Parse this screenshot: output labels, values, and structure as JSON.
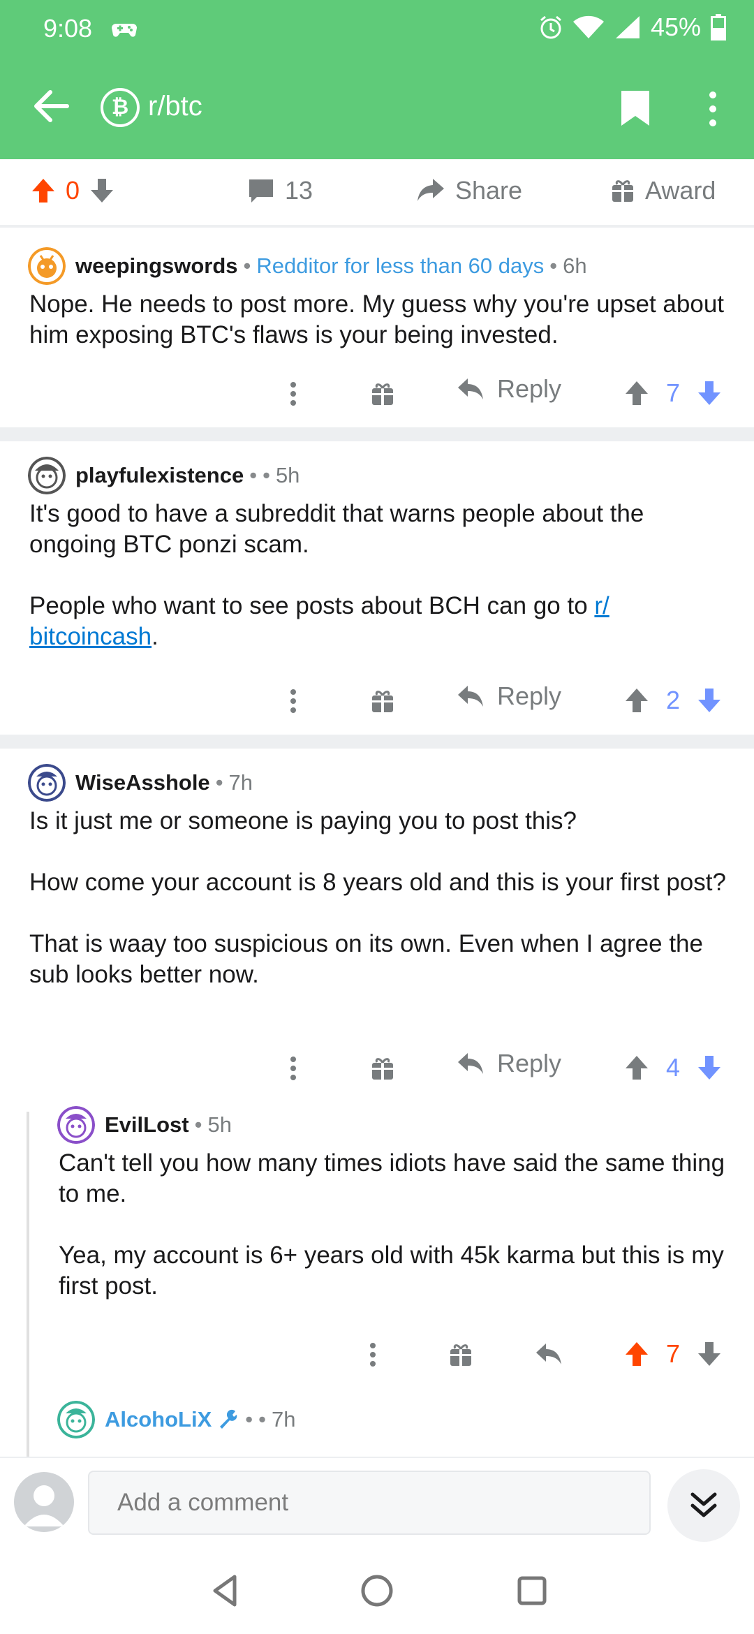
{
  "status_bar": {
    "time": "9:08",
    "battery": "45%"
  },
  "header": {
    "subreddit": "r/btc",
    "subreddit_icon": "bitcoin-icon"
  },
  "post_actions": {
    "score": "0",
    "comments": "13",
    "share_label": "Share",
    "award_label": "Award"
  },
  "comments": [
    {
      "author": "weepingswords",
      "flair": "Redditor for less than 60 days",
      "age": "6h",
      "paragraphs": [
        "Nope. He needs to post more. My guess why you're upset about him exposing BTC's flaws is your being invested."
      ],
      "reply_label": "Reply",
      "score": "7"
    },
    {
      "author": "playfulexistence",
      "flair": "",
      "age": "5h",
      "paragraphs": [
        "It's good to have a subreddit that warns people about the ongoing BTC ponzi scam."
      ],
      "paragraph2_prefix": "People who want to see posts about BCH can go to ",
      "link_line1": "r/",
      "link_line2": "bitcoincash",
      "paragraph2_suffix": ".",
      "reply_label": "Reply",
      "score": "2"
    },
    {
      "author": "WiseAsshole",
      "age": "7h",
      "paragraphs": [
        "Is it just me or someone is paying you to post this?",
        "How come your account is 8 years old and this is your first post?",
        "That is waay too suspicious on its own. Even when I agree the sub looks better now."
      ],
      "reply_label": "Reply",
      "score": "4"
    },
    {
      "author": "EvilLost",
      "age": "5h",
      "paragraphs": [
        "Can't tell you how many times idiots have said the same thing to me.",
        "Yea, my account is 6+ years old with 45k karma but this is my first post."
      ],
      "score": "7"
    },
    {
      "author": "AlcohoLiX",
      "age": "7h"
    }
  ],
  "composer": {
    "placeholder": "Add a comment"
  },
  "colors": {
    "header_green": "#5fcb79",
    "upvote_orange": "#ff4500",
    "downvote_blue": "#7193ff",
    "flair_blue": "#3d9be0"
  }
}
